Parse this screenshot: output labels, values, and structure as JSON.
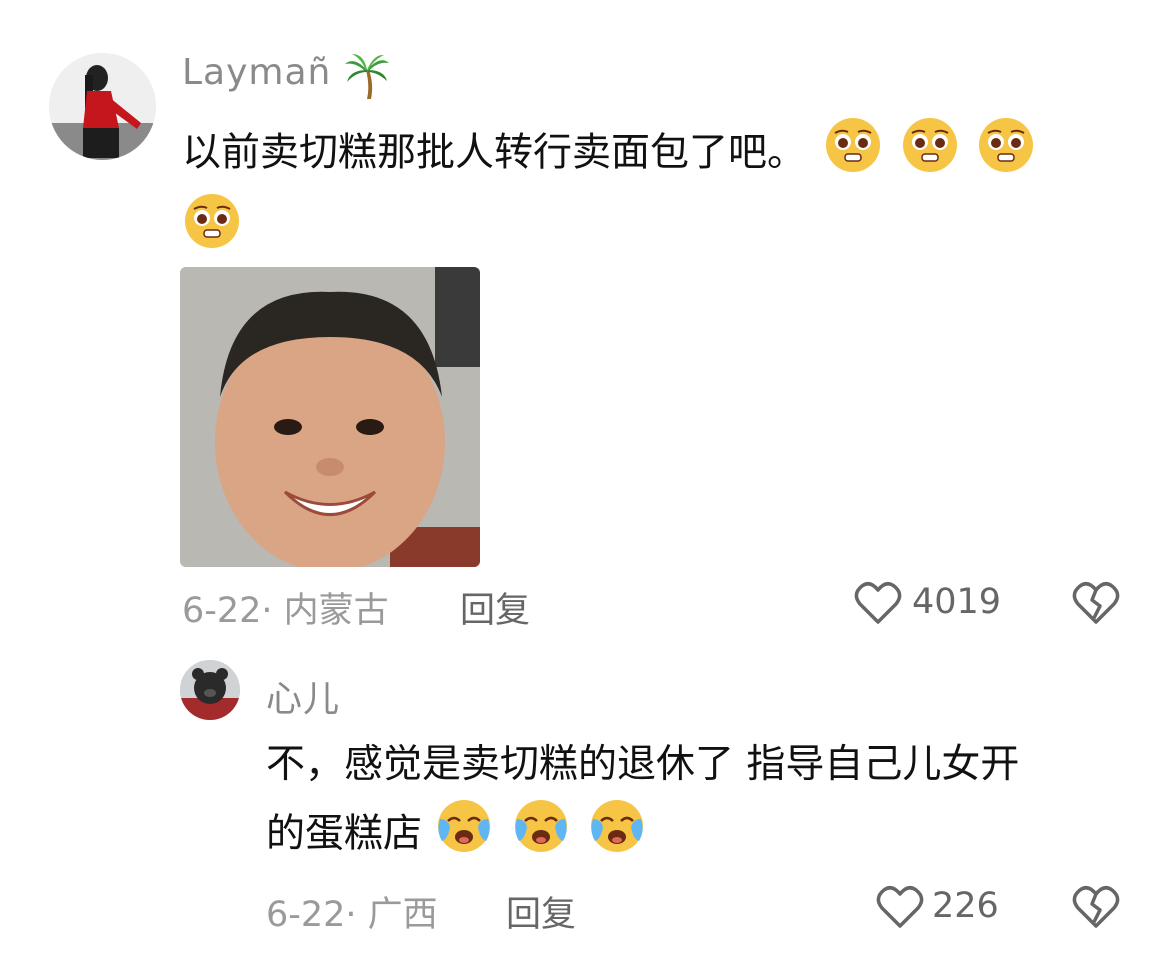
{
  "comments": [
    {
      "username": "Laymañ",
      "username_emoji": "palm-tree-icon",
      "text_line1": "以前卖切糕那批人转行卖面包了吧。",
      "emoji": "pleading-face-icon",
      "date_location": "6-22· 内蒙古",
      "reply_label": "回复",
      "likes": "4019"
    },
    {
      "username": "心儿",
      "text_line1": "不，感觉是卖切糕的退休了 指导自己儿女开",
      "text_line2": "的蛋糕店",
      "emoji": "crying-face-icon",
      "date_location": "6-22· 广西",
      "reply_label": "回复",
      "likes": "226"
    }
  ],
  "colors": {
    "username": "#8a8a8a",
    "meta": "#9a9a9a",
    "emoji_yellow": "#f7c545"
  }
}
